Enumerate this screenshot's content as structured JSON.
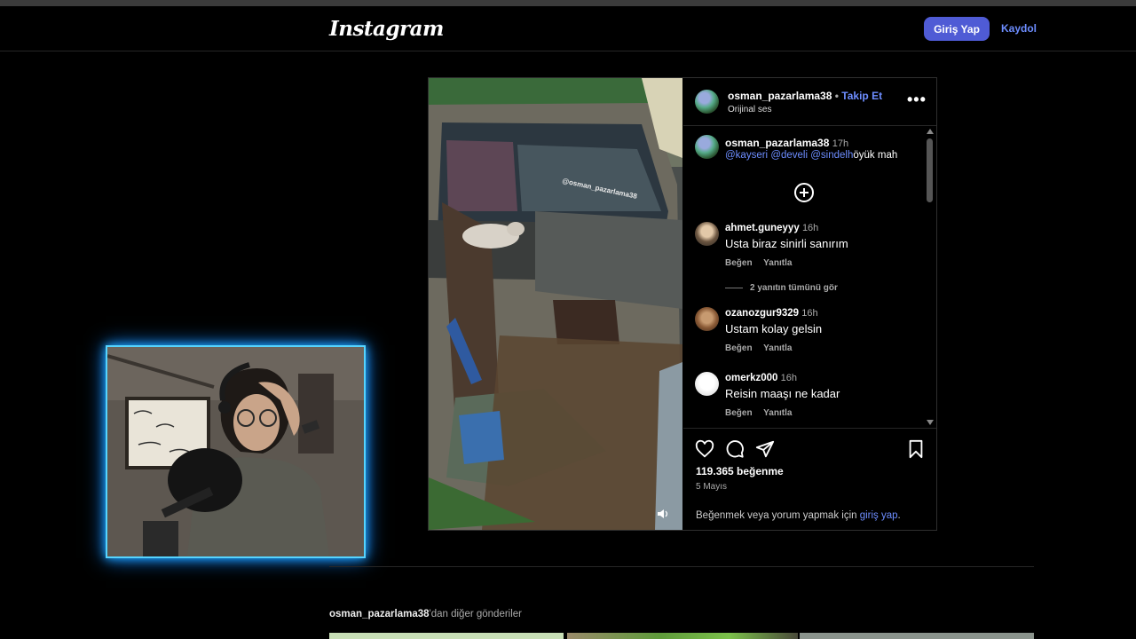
{
  "nav": {
    "logo": "Instagram",
    "login_button": "Giriş Yap",
    "signup_link": "Kaydol"
  },
  "post": {
    "watermark": "@osman_pazarlama38",
    "header": {
      "username": "osman_pazarlama38",
      "separator": "•",
      "follow": "Takip Et",
      "subtitle": "Orijinal ses",
      "more": "•••"
    },
    "caption": {
      "username": "osman_pazarlama38",
      "time": "17h",
      "mentions": [
        "@kayseri",
        "@develi",
        "@sindelh"
      ],
      "text_tail": "öyük mah"
    },
    "comments": [
      {
        "username": "ahmet.guneyyy",
        "time": "16h",
        "text": "Usta biraz sinirli sanırım",
        "like": "Beğen",
        "reply": "Yanıtla",
        "view_replies": "2 yanıtın tümünü gör"
      },
      {
        "username": "ozanozgur9329",
        "time": "16h",
        "text": "Ustam kolay gelsin",
        "like": "Beğen",
        "reply": "Yanıtla"
      },
      {
        "username": "omerkz000",
        "time": "16h",
        "text": "Reisin maaşı ne kadar",
        "like": "Beğen",
        "reply": "Yanıtla"
      }
    ],
    "likes": "119.365 beğenme",
    "date": "5 Mayıs",
    "login_hint_prefix": "Beğenmek veya yorum yapmak için ",
    "login_hint_link": "giriş yap",
    "login_hint_suffix": "."
  },
  "more_posts": {
    "username": "osman_pazarlama38",
    "suffix": "'dan diğer gönderiler"
  },
  "colors": {
    "accent_blue": "#4f5bd5",
    "link_blue": "#6d8dff",
    "webcam_glow": "#1fa8ff"
  },
  "icons": [
    "heart-icon",
    "comment-icon",
    "share-icon",
    "bookmark-icon",
    "more-icon",
    "add-comment-icon",
    "volume-icon"
  ]
}
